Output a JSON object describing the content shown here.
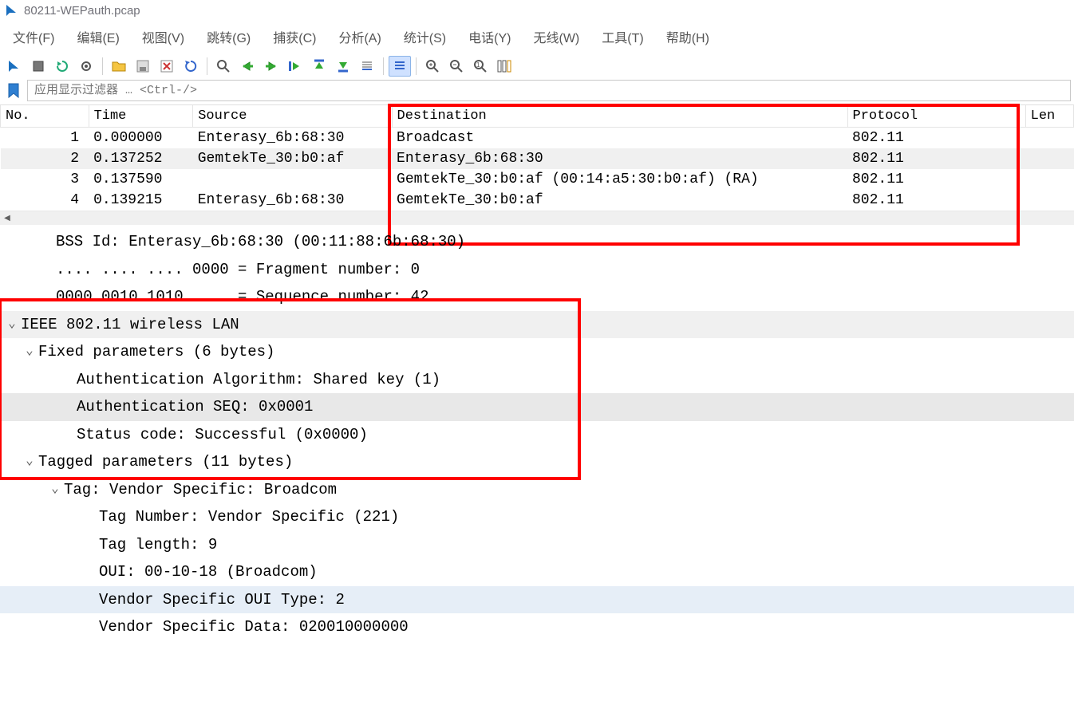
{
  "window": {
    "title": "80211-WEPauth.pcap"
  },
  "menu": {
    "items": [
      {
        "label": "文件(F)"
      },
      {
        "label": "编辑(E)"
      },
      {
        "label": "视图(V)"
      },
      {
        "label": "跳转(G)"
      },
      {
        "label": "捕获(C)"
      },
      {
        "label": "分析(A)"
      },
      {
        "label": "统计(S)"
      },
      {
        "label": "电话(Y)"
      },
      {
        "label": "无线(W)"
      },
      {
        "label": "工具(T)"
      },
      {
        "label": "帮助(H)"
      }
    ]
  },
  "filter": {
    "placeholder": "应用显示过滤器 … <Ctrl-/>"
  },
  "packet_list": {
    "headers": {
      "no": "No.",
      "time": "Time",
      "source": "Source",
      "destination": "Destination",
      "protocol": "Protocol",
      "length": "Len"
    },
    "rows": [
      {
        "no": "1",
        "time": "0.000000",
        "source": "Enterasy_6b:68:30",
        "dest": "Broadcast",
        "proto": "802.11",
        "selected": false
      },
      {
        "no": "2",
        "time": "0.137252",
        "source": "GemtekTe_30:b0:af",
        "dest": "Enterasy_6b:68:30",
        "proto": "802.11",
        "selected": true
      },
      {
        "no": "3",
        "time": "0.137590",
        "source": "",
        "dest": "GemtekTe_30:b0:af (00:14:a5:30:b0:af) (RA)",
        "proto": "802.11",
        "selected": false
      },
      {
        "no": "4",
        "time": "0.139215",
        "source": "Enterasy_6b:68:30",
        "dest": "GemtekTe_30:b0:af",
        "proto": "802.11",
        "selected": false
      }
    ]
  },
  "details": {
    "lines": [
      {
        "indent": 52,
        "caret": "none",
        "text": "BSS Id: Enterasy_6b:68:30 (00:11:88:6b:68:30)",
        "hl": ""
      },
      {
        "indent": 52,
        "caret": "none",
        "text": ".... .... .... 0000 = Fragment number: 0",
        "hl": ""
      },
      {
        "indent": 52,
        "caret": "none",
        "text": "0000 0010 1010 .... = Sequence number: 42",
        "hl": ""
      },
      {
        "indent": 8,
        "caret": "open",
        "text": "IEEE 802.11 wireless LAN",
        "hl": "hl-lightgray"
      },
      {
        "indent": 30,
        "caret": "open",
        "text": "Fixed parameters (6 bytes)",
        "hl": ""
      },
      {
        "indent": 78,
        "caret": "none",
        "text": "Authentication Algorithm: Shared key (1)",
        "hl": ""
      },
      {
        "indent": 78,
        "caret": "none",
        "text": "Authentication SEQ: 0x0001",
        "hl": "hl-gray"
      },
      {
        "indent": 78,
        "caret": "none",
        "text": "Status code: Successful (0x0000)",
        "hl": ""
      },
      {
        "indent": 30,
        "caret": "open",
        "text": "Tagged parameters (11 bytes)",
        "hl": ""
      },
      {
        "indent": 62,
        "caret": "open",
        "text": "Tag: Vendor Specific: Broadcom",
        "hl": ""
      },
      {
        "indent": 106,
        "caret": "none",
        "text": "Tag Number: Vendor Specific (221)",
        "hl": ""
      },
      {
        "indent": 106,
        "caret": "none",
        "text": "Tag length: 9",
        "hl": ""
      },
      {
        "indent": 106,
        "caret": "none",
        "text": "OUI: 00-10-18 (Broadcom)",
        "hl": ""
      },
      {
        "indent": 106,
        "caret": "none",
        "text": "Vendor Specific OUI Type: 2",
        "hl": "hl-blue"
      },
      {
        "indent": 106,
        "caret": "none",
        "text": "Vendor Specific Data: 020010000000",
        "hl": ""
      }
    ]
  }
}
